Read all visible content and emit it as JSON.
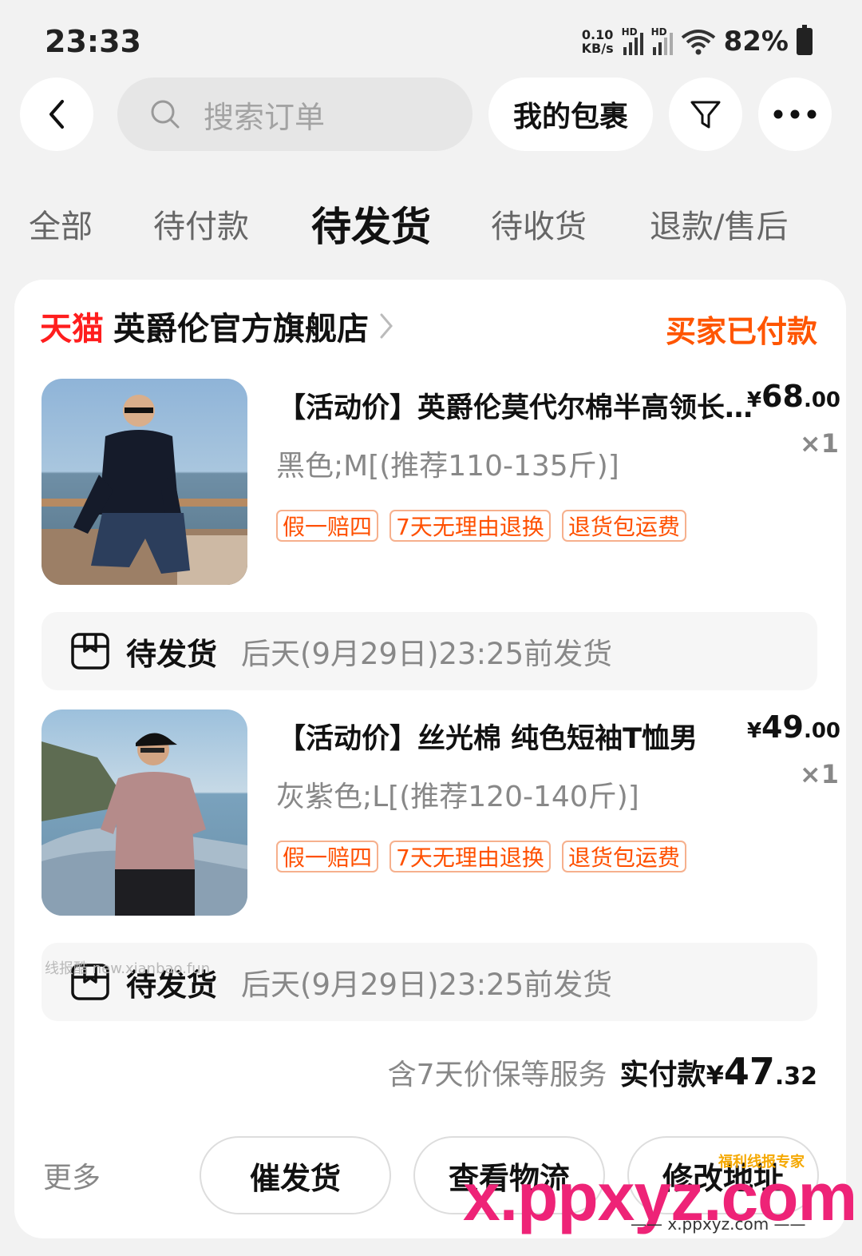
{
  "status_bar": {
    "time": "23:33",
    "net_speed_value": "0.10",
    "net_speed_unit": "KB/s",
    "signal_label": "HD",
    "battery": "82%"
  },
  "nav": {
    "search_placeholder": "搜索订单",
    "my_packages": "我的包裹",
    "icons": [
      "back-icon",
      "search-icon",
      "filter-icon",
      "more-icon"
    ]
  },
  "tabs": [
    {
      "label": "全部",
      "active": false
    },
    {
      "label": "待付款",
      "active": false
    },
    {
      "label": "待发货",
      "active": true
    },
    {
      "label": "待收货",
      "active": false
    },
    {
      "label": "退款/售后",
      "active": false
    }
  ],
  "order": {
    "platform": "天猫",
    "shop_name": "英爵伦官方旗舰店",
    "status": "买家已付款",
    "items": [
      {
        "title": "【活动价】英爵伦莫代尔棉半高领长袖T恤",
        "price_currency": "¥",
        "price_int": "68",
        "price_dec": ".00",
        "qty": "×1",
        "sku": "黑色;M[(推荐110-135斤)]",
        "tags": [
          "假一赔四",
          "7天无理由退换",
          "退货包运费"
        ],
        "ship_label": "待发货",
        "ship_desc": "后天(9月29日)23:25前发货"
      },
      {
        "title": "【活动价】丝光棉 纯色短袖T恤男",
        "price_currency": "¥",
        "price_int": "49",
        "price_dec": ".00",
        "qty": "×1",
        "sku": "灰紫色;L[(推荐120-140斤)]",
        "tags": [
          "假一赔四",
          "7天无理由退换",
          "退货包运费"
        ],
        "ship_label": "待发货",
        "ship_desc": "后天(9月29日)23:25前发货"
      }
    ],
    "service_note": "含7天价保等服务",
    "paid_label": "实付款",
    "paid_currency": "¥",
    "paid_int": "47",
    "paid_dec": ".32",
    "more": "更多",
    "actions": [
      "催发货",
      "查看物流",
      "修改地址"
    ]
  },
  "watermarks": {
    "small": "线报酷 new.xianbao.fun",
    "brand": "x.ppxyz.com",
    "brand_small": "—— x.ppxyz.com ——",
    "brand_tag": "福利线报专家"
  },
  "colors": {
    "accent_orange": "#ff5500",
    "tmall_red": "#ff1e1e",
    "tag_border": "#f6b08d",
    "page_bg": "#f2f2f2"
  }
}
